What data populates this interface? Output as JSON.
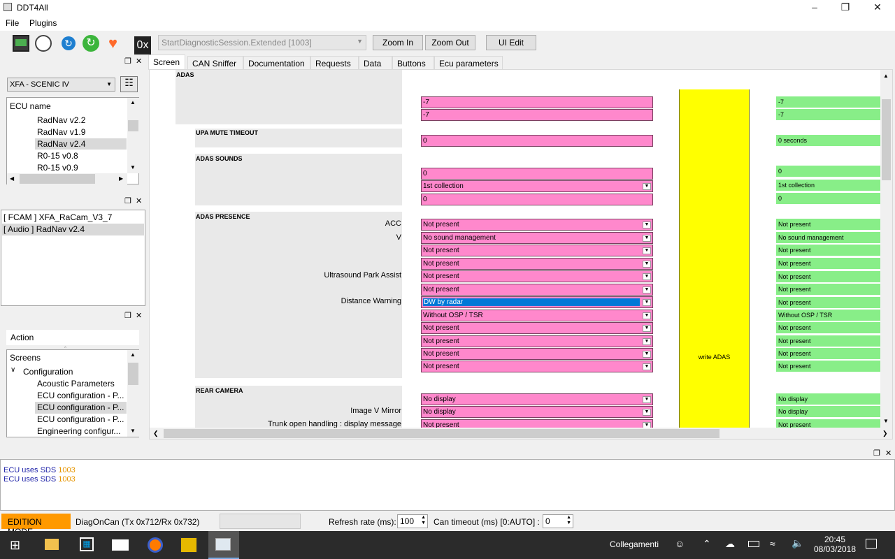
{
  "window": {
    "title": "DDT4All"
  },
  "menu": [
    "File",
    "Plugins"
  ],
  "toolbar": {
    "session_value": "StartDiagnosticSession.Extended [1003]",
    "zoom_in": "Zoom In",
    "zoom_out": "Zoom Out",
    "ui_edit": "UI Edit",
    "hex_label": "0x"
  },
  "left": {
    "vehicle": "XFA - SCENIC IV",
    "ecu_header": "ECU name",
    "ecus": [
      "RadNav v2.2",
      "RadNav v1.9",
      "RadNav v2.4",
      "R0-15 v0.8",
      "R0-15 v0.9"
    ],
    "loaded": [
      "[ FCAM ] XFA_RaCam_V3_7",
      "[ Audio ] RadNav v2.4"
    ],
    "action_header": "Action",
    "tree": [
      "Screens",
      "Configuration",
      "Acoustic Parameters",
      "ECU configuration - P...",
      "ECU configuration - P...",
      "ECU configuration - P...",
      "Engineering configur..."
    ]
  },
  "tabs": [
    "Screen",
    "CAN Sniffer",
    "Documentation",
    "Requests",
    "Data",
    "Buttons",
    "Ecu parameters"
  ],
  "screen": {
    "sections": {
      "adas": "ADAS",
      "upa": "UPA MUTE TIMEOUT",
      "sounds": "ADAS SOUNDS",
      "presence": "ADAS PRESENCE",
      "camera": "REAR CAMERA"
    },
    "labels": {
      "acc": "ACC",
      "v": "V",
      "ultrasound": "Ultrasound Park Assist",
      "distance": "Distance Warning",
      "mirror": "Image V Mirror",
      "trunk": "Trunk open handling : display message"
    },
    "pink": [
      "-7",
      "-7",
      "0",
      "0",
      "1st collection",
      "0",
      "Not present",
      "No sound management",
      "Not present",
      "Not present",
      "Not present",
      "Not present",
      "DW by radar",
      "Without OSP / TSR",
      "Not present",
      "Not present",
      "Not present",
      "Not present",
      "No display",
      "No display",
      "Not present"
    ],
    "green": [
      "-7",
      "-7",
      "0 seconds",
      "0",
      "1st collection",
      "0",
      "Not present",
      "No sound management",
      "Not present",
      "Not present",
      "Not present",
      "Not present",
      "Not present",
      "Without OSP / TSR",
      "Not present",
      "Not present",
      "Not present",
      "Not present",
      "No display",
      "No display",
      "Not present"
    ],
    "write_button": "write ADAS"
  },
  "log": {
    "lines": [
      {
        "text": "ECU uses SDS",
        "code": "1003"
      },
      {
        "text": "ECU uses SDS",
        "code": "1003"
      }
    ]
  },
  "status": {
    "mode": "EDITION MODE",
    "protocol": "DiagOnCan (Tx 0x712/Rx 0x732)",
    "refresh_label": "Refresh rate (ms):",
    "refresh_value": "100",
    "timeout_label": "Can timeout (ms) [0:AUTO] :",
    "timeout_value": "0"
  },
  "taskbar": {
    "network_label": "Collegamenti",
    "time": "20:45",
    "date": "08/03/2018"
  },
  "colors": {
    "pink": "#ff88cc",
    "green": "#88ee88",
    "yellow": "#ffff00",
    "edition": "#ff9900",
    "code": "#e69500"
  }
}
